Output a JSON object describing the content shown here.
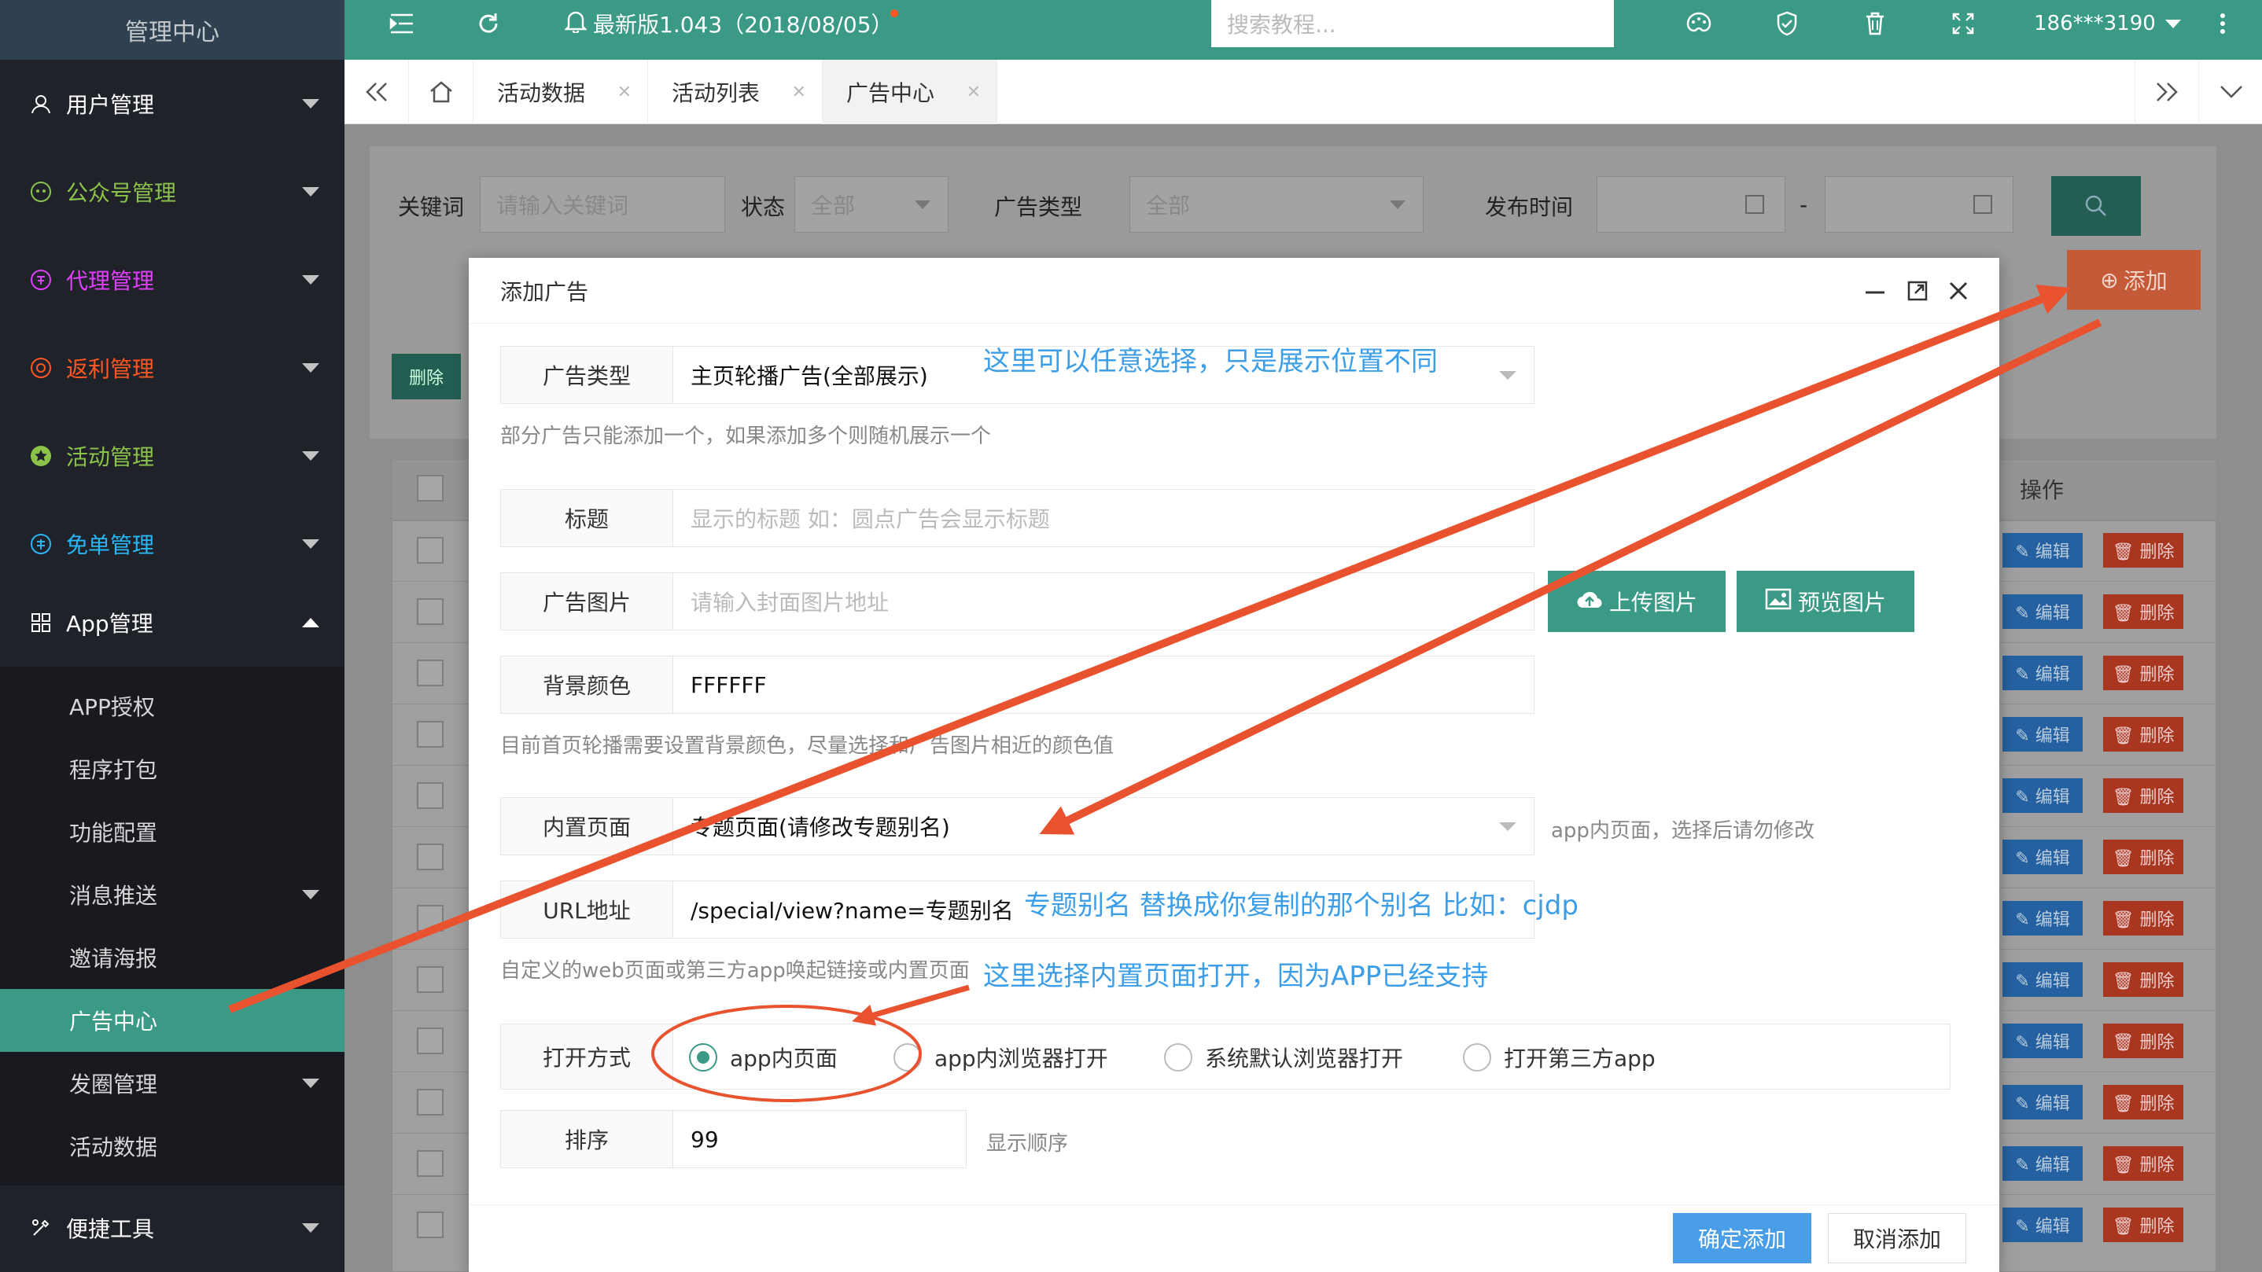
{
  "sidebar": {
    "title": "管理中心",
    "menu": [
      {
        "label": "用户管理",
        "icon": "user-icon",
        "color": "#ffffff"
      },
      {
        "label": "公众号管理",
        "icon": "wechat-icon",
        "color": "#8bc34a"
      },
      {
        "label": "代理管理",
        "icon": "agent-icon",
        "color": "#e040fb"
      },
      {
        "label": "返利管理",
        "icon": "rebate-icon",
        "color": "#ff5722"
      },
      {
        "label": "活动管理",
        "icon": "star-icon",
        "color": "#8bc34a"
      },
      {
        "label": "免单管理",
        "icon": "free-icon",
        "color": "#29b6f6"
      },
      {
        "label": "App管理",
        "icon": "grid-icon",
        "color": "#ffffff"
      }
    ],
    "submenu": [
      "APP授权",
      "程序打包",
      "功能配置",
      "消息推送",
      "邀请海报",
      "广告中心",
      "发圈管理",
      "活动数据"
    ],
    "active_sub": "广告中心",
    "tools": {
      "label": "便捷工具",
      "icon": "tools-icon"
    }
  },
  "topbar": {
    "version": "最新版1.043（2018/08/05）",
    "search_placeholder": "搜索教程...",
    "user": "186***3190"
  },
  "tabs": [
    "活动数据",
    "活动列表",
    "广告中心"
  ],
  "filter": {
    "keyword_label": "关键词",
    "keyword_placeholder": "请输入关键词",
    "status_label": "状态",
    "status_value": "全部",
    "type_label": "广告类型",
    "type_value": "全部",
    "time_label": "发布时间",
    "time_sep": "-"
  },
  "toolbar": {
    "add_label": "添加",
    "delete_label": "删除"
  },
  "table": {
    "ops_header": "操作",
    "edit_label": "编辑",
    "delete_label": "删除"
  },
  "modal": {
    "title": "添加广告",
    "fields": {
      "ad_type_label": "广告类型",
      "ad_type_value": "主页轮播广告(全部展示)",
      "ad_type_help": "部分广告只能添加一个，如果添加多个则随机展示一个",
      "title_label": "标题",
      "title_placeholder": "显示的标题 如：圆点广告会显示标题",
      "image_label": "广告图片",
      "image_placeholder": "请输入封面图片地址",
      "upload_button": "上传图片",
      "preview_button": "预览图片",
      "bg_label": "背景颜色",
      "bg_value": "FFFFFF",
      "bg_help": "目前首页轮播需要设置背景颜色，尽量选择和广告图片相近的颜色值",
      "page_label": "内置页面",
      "page_value": "专题页面(请修改专题别名)",
      "page_help": "app内页面，选择后请勿修改",
      "url_label": "URL地址",
      "url_value": "/special/view?name=专题别名",
      "url_help": "自定义的web页面或第三方app唤起链接或内置页面",
      "open_label": "打开方式",
      "open_options": [
        "app内页面",
        "app内浏览器打开",
        "系统默认浏览器打开",
        "打开第三方app"
      ],
      "sort_label": "排序",
      "sort_value": "99",
      "sort_help": "显示顺序"
    },
    "confirm_button": "确定添加",
    "cancel_button": "取消添加"
  },
  "annotations": {
    "note1": "这里可以任意选择，只是展示位置不同",
    "note2": "专题别名 替换成你复制的那个别名 比如：cjdp",
    "note3": "这里选择内置页面打开，因为APP已经支持"
  },
  "colors": {
    "brand": "#3a9a86",
    "arrow": "#e8522e",
    "note": "#3d9ee8",
    "primary_button": "#4a9ee8"
  }
}
